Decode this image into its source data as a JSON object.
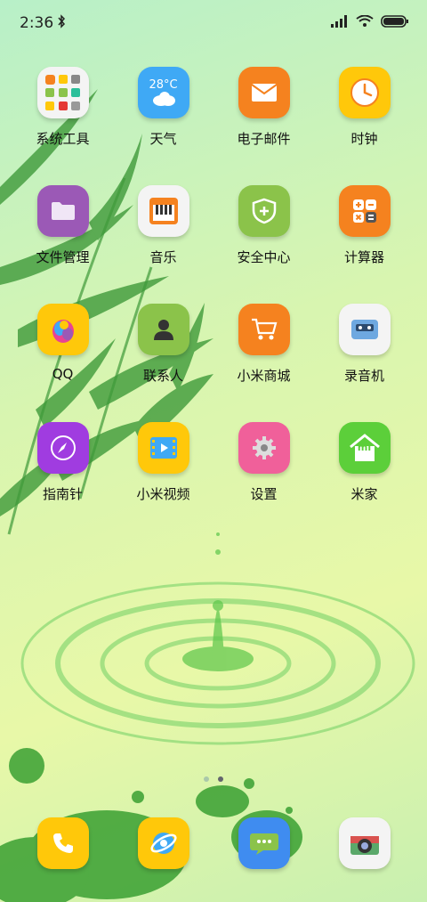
{
  "status_bar": {
    "time": "2:36"
  },
  "apps": [
    {
      "name": "系统工具"
    },
    {
      "name": "天气",
      "weather_temp": "28°C"
    },
    {
      "name": "电子邮件"
    },
    {
      "name": "时钟"
    },
    {
      "name": "文件管理"
    },
    {
      "name": "音乐"
    },
    {
      "name": "安全中心"
    },
    {
      "name": "计算器"
    },
    {
      "name": "QQ"
    },
    {
      "name": "联系人"
    },
    {
      "name": "小米商城"
    },
    {
      "name": "录音机"
    },
    {
      "name": "指南针"
    },
    {
      "name": "小米视频"
    },
    {
      "name": "设置"
    },
    {
      "name": "米家",
      "badge_text": "mi"
    }
  ],
  "dock_icons": [
    "phone-icon",
    "browser-icon",
    "messages-icon",
    "camera-icon"
  ],
  "page_indicator": {
    "total": 2,
    "current": 2
  },
  "colors": {
    "orange": "#F5821F",
    "yellow": "#FFC80A",
    "purple": "#9B59B6",
    "green": "#8BC34A",
    "blue": "#3FA9F5",
    "pink": "#F0609A"
  }
}
